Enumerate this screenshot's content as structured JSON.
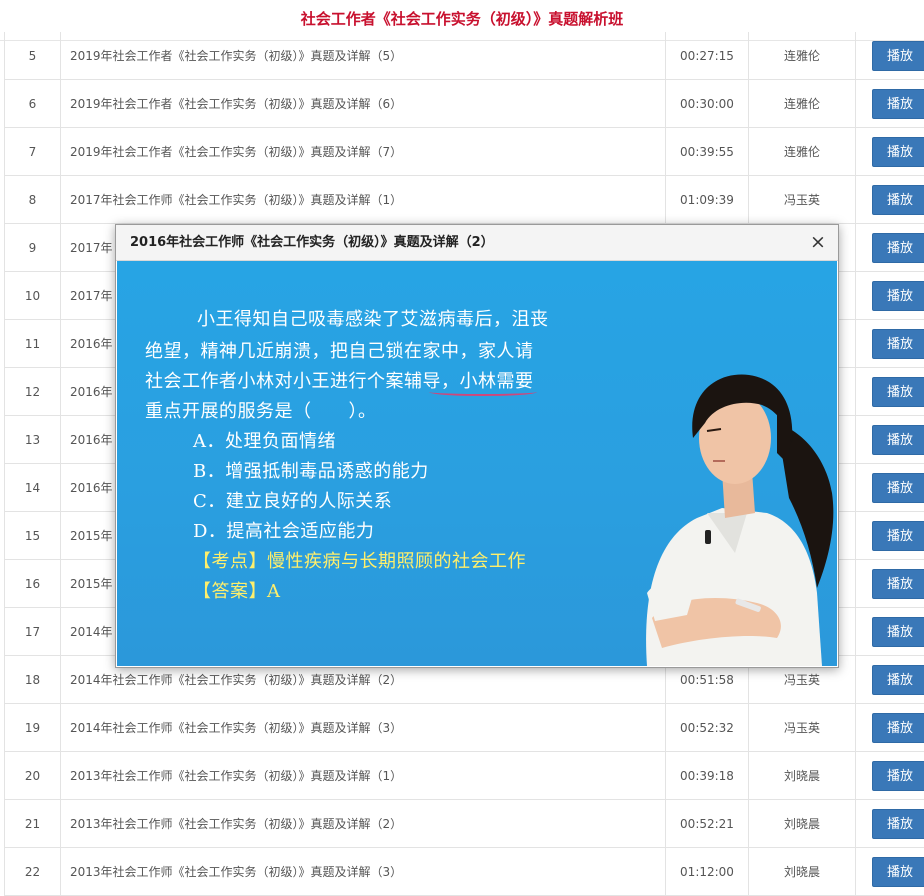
{
  "header": {
    "title": "社会工作者《社会工作实务（初级）》真题解析班"
  },
  "rows": [
    {
      "no": "5",
      "title": "2019年社会工作者《社会工作实务（初级）》真题及详解（5）",
      "duration": "00:27:15",
      "teacher": "连雅伦",
      "action": "播放"
    },
    {
      "no": "6",
      "title": "2019年社会工作者《社会工作实务（初级）》真题及详解（6）",
      "duration": "00:30:00",
      "teacher": "连雅伦",
      "action": "播放"
    },
    {
      "no": "7",
      "title": "2019年社会工作者《社会工作实务（初级）》真题及详解（7）",
      "duration": "00:39:55",
      "teacher": "连雅伦",
      "action": "播放"
    },
    {
      "no": "8",
      "title": "2017年社会工作师《社会工作实务（初级）》真题及详解（1）",
      "duration": "01:09:39",
      "teacher": "冯玉英",
      "action": "播放"
    },
    {
      "no": "9",
      "title": "2017年",
      "duration": "",
      "teacher": "",
      "action": "播放"
    },
    {
      "no": "10",
      "title": "2017年",
      "duration": "",
      "teacher": "",
      "action": "播放"
    },
    {
      "no": "11",
      "title": "2016年",
      "duration": "",
      "teacher": "",
      "action": "播放"
    },
    {
      "no": "12",
      "title": "2016年",
      "duration": "",
      "teacher": "",
      "action": "播放"
    },
    {
      "no": "13",
      "title": "2016年",
      "duration": "",
      "teacher": "",
      "action": "播放"
    },
    {
      "no": "14",
      "title": "2016年",
      "duration": "",
      "teacher": "",
      "action": "播放"
    },
    {
      "no": "15",
      "title": "2015年",
      "duration": "",
      "teacher": "",
      "action": "播放"
    },
    {
      "no": "16",
      "title": "2015年",
      "duration": "",
      "teacher": "",
      "action": "播放"
    },
    {
      "no": "17",
      "title": "2014年",
      "duration": "",
      "teacher": "",
      "action": "播放"
    },
    {
      "no": "18",
      "title": "2014年社会工作师《社会工作实务（初级）》真题及详解（2）",
      "duration": "00:51:58",
      "teacher": "冯玉英",
      "action": "播放"
    },
    {
      "no": "19",
      "title": "2014年社会工作师《社会工作实务（初级）》真题及详解（3）",
      "duration": "00:52:32",
      "teacher": "冯玉英",
      "action": "播放"
    },
    {
      "no": "20",
      "title": "2013年社会工作师《社会工作实务（初级）》真题及详解（1）",
      "duration": "00:39:18",
      "teacher": "刘晓晨",
      "action": "播放"
    },
    {
      "no": "21",
      "title": "2013年社会工作师《社会工作实务（初级）》真题及详解（2）",
      "duration": "00:52:21",
      "teacher": "刘晓晨",
      "action": "播放"
    },
    {
      "no": "22",
      "title": "2013年社会工作师《社会工作实务（初级）》真题及详解（3）",
      "duration": "01:12:00",
      "teacher": "刘晓晨",
      "action": "播放"
    }
  ],
  "modal": {
    "title": "2016年社会工作师《社会工作实务（初级）》真题及详解（2）",
    "close_icon": "×",
    "video_lines": [
      "小王得知自己吸毒感染了艾滋病毒后，沮丧",
      "绝望，精神几近崩溃，把自己锁在家中，家人请",
      "社会工作者小林对小王进行个案辅导，小林需要",
      "重点开展的服务是（　　）。",
      "A．处理负面情绪",
      "B．增强抵制毒品诱惑的能力",
      "C．建立良好的人际关系",
      "D．提高社会适应能力",
      "【考点】慢性疾病与长期照顾的社会工作",
      "【答案】A"
    ]
  },
  "colors": {
    "title_red": "#c8102e",
    "button_blue": "#3a78b8",
    "video_blue": "#29a2e2"
  }
}
